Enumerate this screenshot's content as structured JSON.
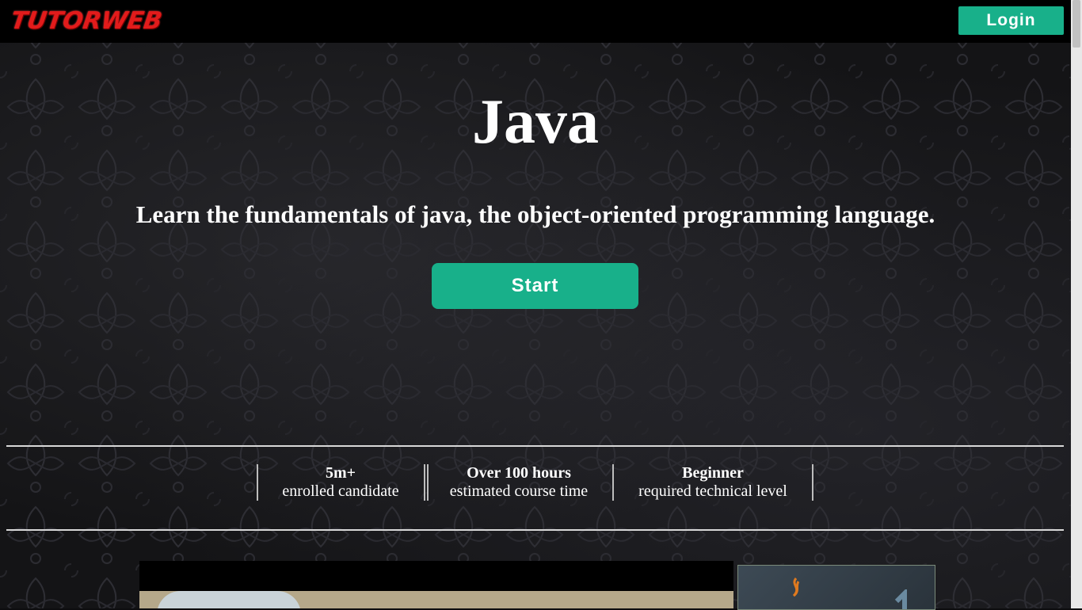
{
  "header": {
    "logo_text": "TUTORWEB",
    "login_label": "Login"
  },
  "hero": {
    "title": "Java",
    "subtitle": "Learn the fundamentals of java, the object-oriented programming language.",
    "start_label": "Start"
  },
  "stats": [
    {
      "value": "5m+",
      "label": "enrolled candidate"
    },
    {
      "value": "Over 100 hours",
      "label": "estimated course time"
    },
    {
      "value": "Beginner",
      "label": "required technical level"
    }
  ],
  "colors": {
    "accent": "#18b08a",
    "logo": "#e21b1b",
    "background": "#141416",
    "topbar": "#000000"
  },
  "icons": {
    "java_logo": "java-logo-icon"
  }
}
